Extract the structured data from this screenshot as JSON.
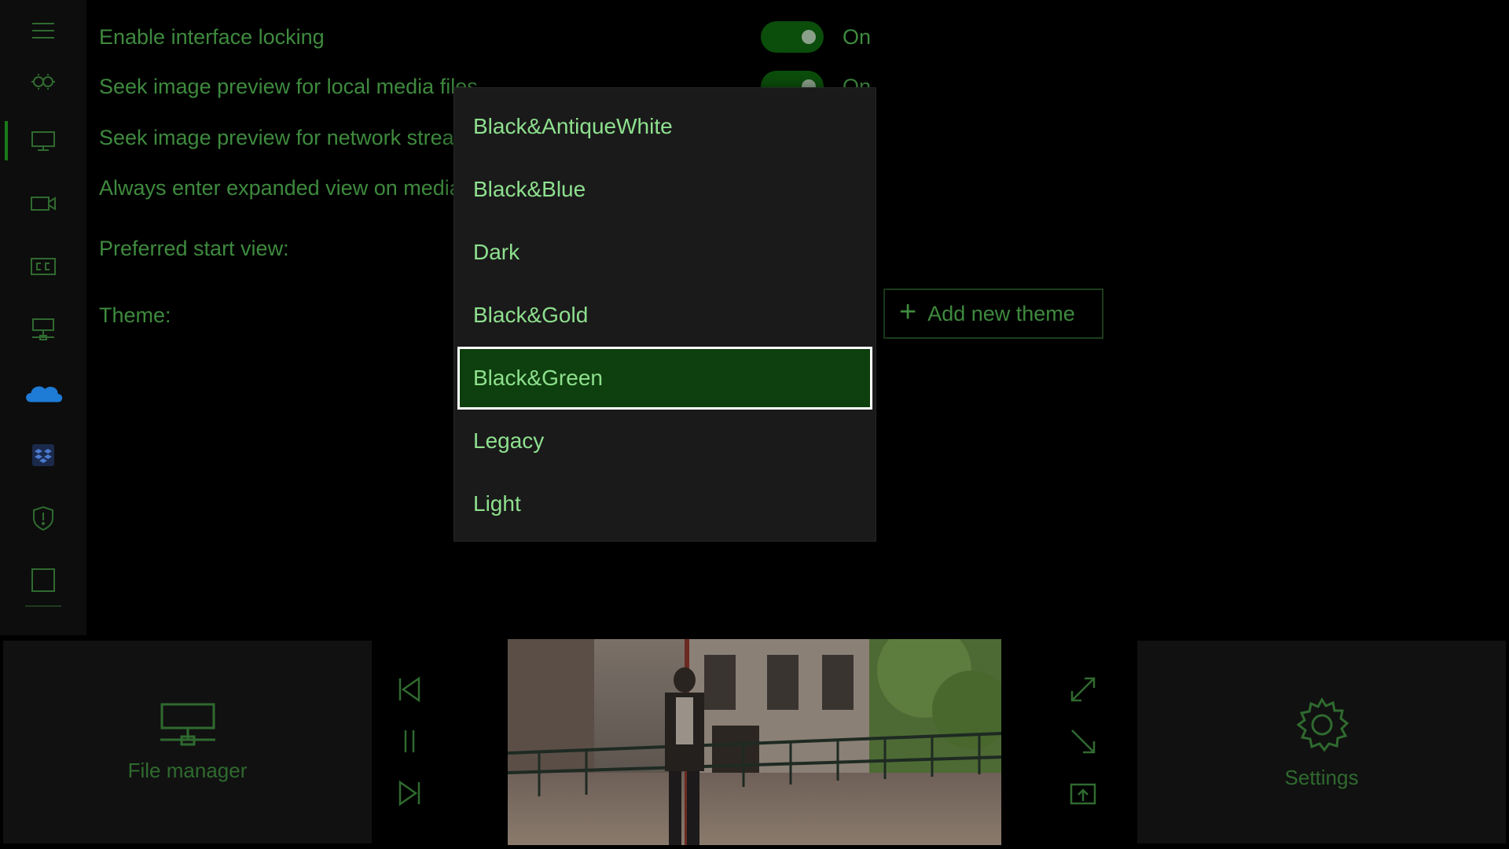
{
  "settings": {
    "interface_locking": {
      "label": "Enable interface locking",
      "state": "On"
    },
    "seek_local": {
      "label": "Seek image preview for local media files",
      "state": "On"
    },
    "seek_network": {
      "label": "Seek image preview for network streams"
    },
    "expanded_view": {
      "label": "Always enter expanded view on media playback"
    },
    "start_view": {
      "label": "Preferred start view:"
    },
    "theme": {
      "label": "Theme:",
      "add_button": "Add new theme"
    }
  },
  "theme_dropdown": {
    "options": [
      "Black&AntiqueWhite",
      "Black&Blue",
      "Dark",
      "Black&Gold",
      "Black&Green",
      "Legacy",
      "Light"
    ],
    "selected_index": 4
  },
  "sidebar": {
    "items": [
      "menu-icon",
      "general-icon",
      "display-icon",
      "video-icon",
      "captions-icon",
      "network-icon",
      "onedrive-icon",
      "dropbox-icon",
      "privacy-icon",
      "screen-icon"
    ]
  },
  "bottom": {
    "file_manager_label": "File manager",
    "settings_label": "Settings"
  },
  "colors": {
    "accent": "#5fbf5f",
    "option_text": "#8ee08e",
    "selected_bg": "#0e3f0e",
    "toggle_on": "#0b4d0b"
  }
}
